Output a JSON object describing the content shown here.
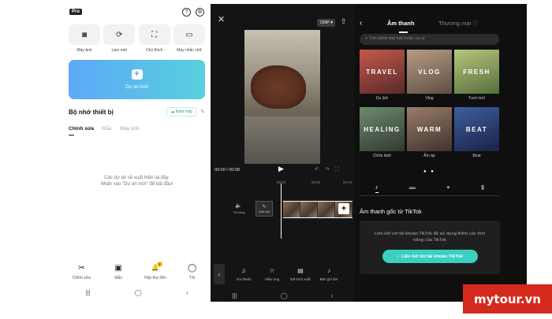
{
  "screen1": {
    "badge": "Pro",
    "tools": [
      {
        "label": "Máy ảnh",
        "icon": "camera-icon",
        "glyph": "◙"
      },
      {
        "label": "Làm mới",
        "icon": "refresh-icon",
        "glyph": "⟳"
      },
      {
        "label": "Chú thích",
        "icon": "caption-icon",
        "glyph": "⛶"
      },
      {
        "label": "Máy nhắc chữ",
        "icon": "teleprompter-icon",
        "glyph": "▭"
      }
    ],
    "new_project": {
      "plus": "+",
      "label": "Dự án mới"
    },
    "storage": {
      "title": "Bộ nhớ thiết bị",
      "cloud": "Đám mây"
    },
    "tabs": [
      "Chỉnh sửa",
      "Mẫu",
      "Mấy ảnh"
    ],
    "empty_line1": "Các dự án sẽ xuất hiện tại đây.",
    "empty_line2": "Nhấn vào \"Dự án mới\" để bắt đầu!",
    "bottom_nav": [
      {
        "label": "Chỉnh sửa",
        "glyph": "✂",
        "icon": "scissors-icon"
      },
      {
        "label": "Mẫu",
        "glyph": "▣",
        "icon": "template-icon"
      },
      {
        "label": "Hộp thư đến",
        "glyph": "🔔",
        "icon": "bell-icon"
      },
      {
        "label": "Tôi",
        "glyph": "◯",
        "icon": "profile-icon"
      }
    ],
    "notification_count": "2"
  },
  "screen2": {
    "resolution": "720P ▾",
    "timecode": "00:00 / 00:08",
    "ruler": [
      "00:00",
      "00:02",
      "00:04"
    ],
    "mute_label": "Tắt tiếng",
    "cover_label": "Ảnh bìa",
    "tools": [
      {
        "label": "Âm thanh",
        "glyph": "♫",
        "icon": "audio-icon"
      },
      {
        "label": "Hiệu ứng",
        "glyph": "☆",
        "icon": "effects-icon"
      },
      {
        "label": "Đã trích xuất",
        "glyph": "▤",
        "icon": "extracted-icon"
      },
      {
        "label": "Bản ghi âm",
        "glyph": "♪",
        "icon": "voiceover-icon"
      }
    ]
  },
  "screen3": {
    "tab_sound": "Âm thanh",
    "tab_commercial": "Thương mại",
    "search_placeholder": "Tìm kiếm bài hát hoặc ca sĩ",
    "categories": [
      {
        "title": "TRAVEL",
        "label": "Du lịch",
        "bg": "#7a3a34"
      },
      {
        "title": "VLOG",
        "label": "Vlog",
        "bg": "#8e7b6a"
      },
      {
        "title": "FRESH",
        "label": "Tươi mới",
        "bg": "#8fa86f"
      },
      {
        "title": "HEALING",
        "label": "Chữa lành",
        "bg": "#5b5c55"
      },
      {
        "title": "WARM",
        "label": "Ấm áp",
        "bg": "#6e5a4e"
      },
      {
        "title": "BEAT",
        "label": "Beat",
        "bg": "#2c3e6e"
      }
    ],
    "tiktok_title": "Âm thanh gốc từ TikTok",
    "tiktok_desc_1": "Liên kết với tài khoản TikTok để sử dụng thêm các tính",
    "tiktok_desc_2": "năng của TikTok",
    "link_button": "Liên kết tới tài khoản TikTok"
  },
  "watermark": "mytour.vn"
}
